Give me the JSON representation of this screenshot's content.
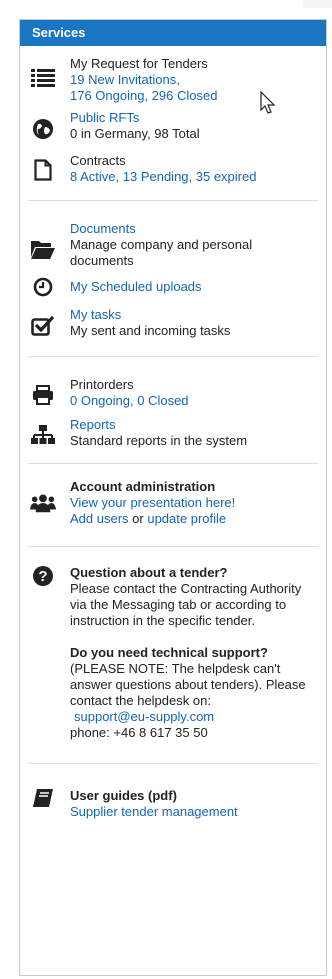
{
  "header": {
    "title": "Services"
  },
  "rfts": {
    "title": "My Request for Tenders",
    "line1": "19 New Invitations,",
    "ongoing": "176 Ongoing,",
    "closed": "296  Closed"
  },
  "public_rfts": {
    "title": "Public RFTs",
    "desc": "0 in Germany,  98 Total"
  },
  "contracts": {
    "title": "Contracts",
    "desc": "8 Active,  13 Pending,  35 expired"
  },
  "documents": {
    "title": "Documents",
    "desc": "Manage company and personal documents"
  },
  "scheduled": {
    "title": "My Scheduled uploads"
  },
  "tasks": {
    "title": "My tasks",
    "desc": "My sent and incoming tasks"
  },
  "printorders": {
    "title": "Printorders",
    "desc": "0 Ongoing,  0 Closed"
  },
  "reports": {
    "title": "Reports",
    "desc": "Standard reports in the system"
  },
  "account": {
    "title": "Account administration",
    "presentation": "View your presentation here!",
    "add_users": "Add users",
    "or": " or ",
    "update_profile": "update profile"
  },
  "help": {
    "q_title": "Question about a tender?",
    "q_body": "Please contact the Contracting Authority via the Messaging tab or according to instruction in the specific tender.",
    "t_title": "Do you need technical support?",
    "t_body": "(PLEASE NOTE: The helpdesk can't answer questions about tenders). Please contact the helpdesk on:",
    "email": "support@eu-supply.com",
    "phone": "phone:  +46 8 617 35 50"
  },
  "guides": {
    "title": "User guides (pdf)",
    "link": "Supplier tender management"
  }
}
